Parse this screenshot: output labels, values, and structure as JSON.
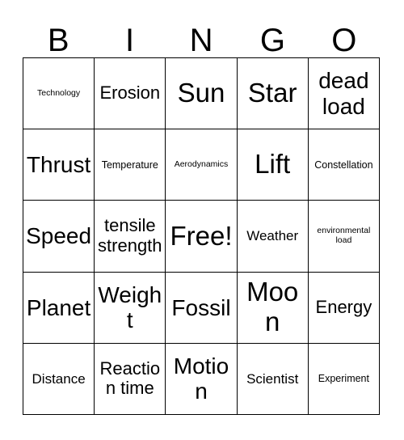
{
  "card": {
    "header_letters": [
      "B",
      "I",
      "N",
      "G",
      "O"
    ],
    "columns": 5,
    "rows": 5,
    "free_space_label": "Free!",
    "cells": [
      [
        {
          "label": "Technology",
          "size": "xs"
        },
        {
          "label": "Erosion",
          "size": "l"
        },
        {
          "label": "Sun",
          "size": "xxl"
        },
        {
          "label": "Star",
          "size": "xxl"
        },
        {
          "label": "dead load",
          "size": "xl"
        }
      ],
      [
        {
          "label": "Thrust",
          "size": "xl"
        },
        {
          "label": "Temperature",
          "size": "s"
        },
        {
          "label": "Aerodynamics",
          "size": "xs"
        },
        {
          "label": "Lift",
          "size": "xxl"
        },
        {
          "label": "Constellation",
          "size": "s"
        }
      ],
      [
        {
          "label": "Speed",
          "size": "xl"
        },
        {
          "label": "tensile strength",
          "size": "l"
        },
        {
          "label": "Free!",
          "size": "xxl"
        },
        {
          "label": "Weather",
          "size": "m"
        },
        {
          "label": "environmental load",
          "size": "xs"
        }
      ],
      [
        {
          "label": "Planet",
          "size": "xl"
        },
        {
          "label": "Weight",
          "size": "xl"
        },
        {
          "label": "Fossil",
          "size": "xl"
        },
        {
          "label": "Moon",
          "size": "xxl"
        },
        {
          "label": "Energy",
          "size": "l"
        }
      ],
      [
        {
          "label": "Distance",
          "size": "m"
        },
        {
          "label": "Reaction time",
          "size": "l"
        },
        {
          "label": "Motion",
          "size": "xl"
        },
        {
          "label": "Scientist",
          "size": "m"
        },
        {
          "label": "Experiment",
          "size": "s"
        }
      ]
    ]
  },
  "colors": {
    "background": "#ffffff",
    "text": "#000000",
    "grid_line": "#000000"
  }
}
